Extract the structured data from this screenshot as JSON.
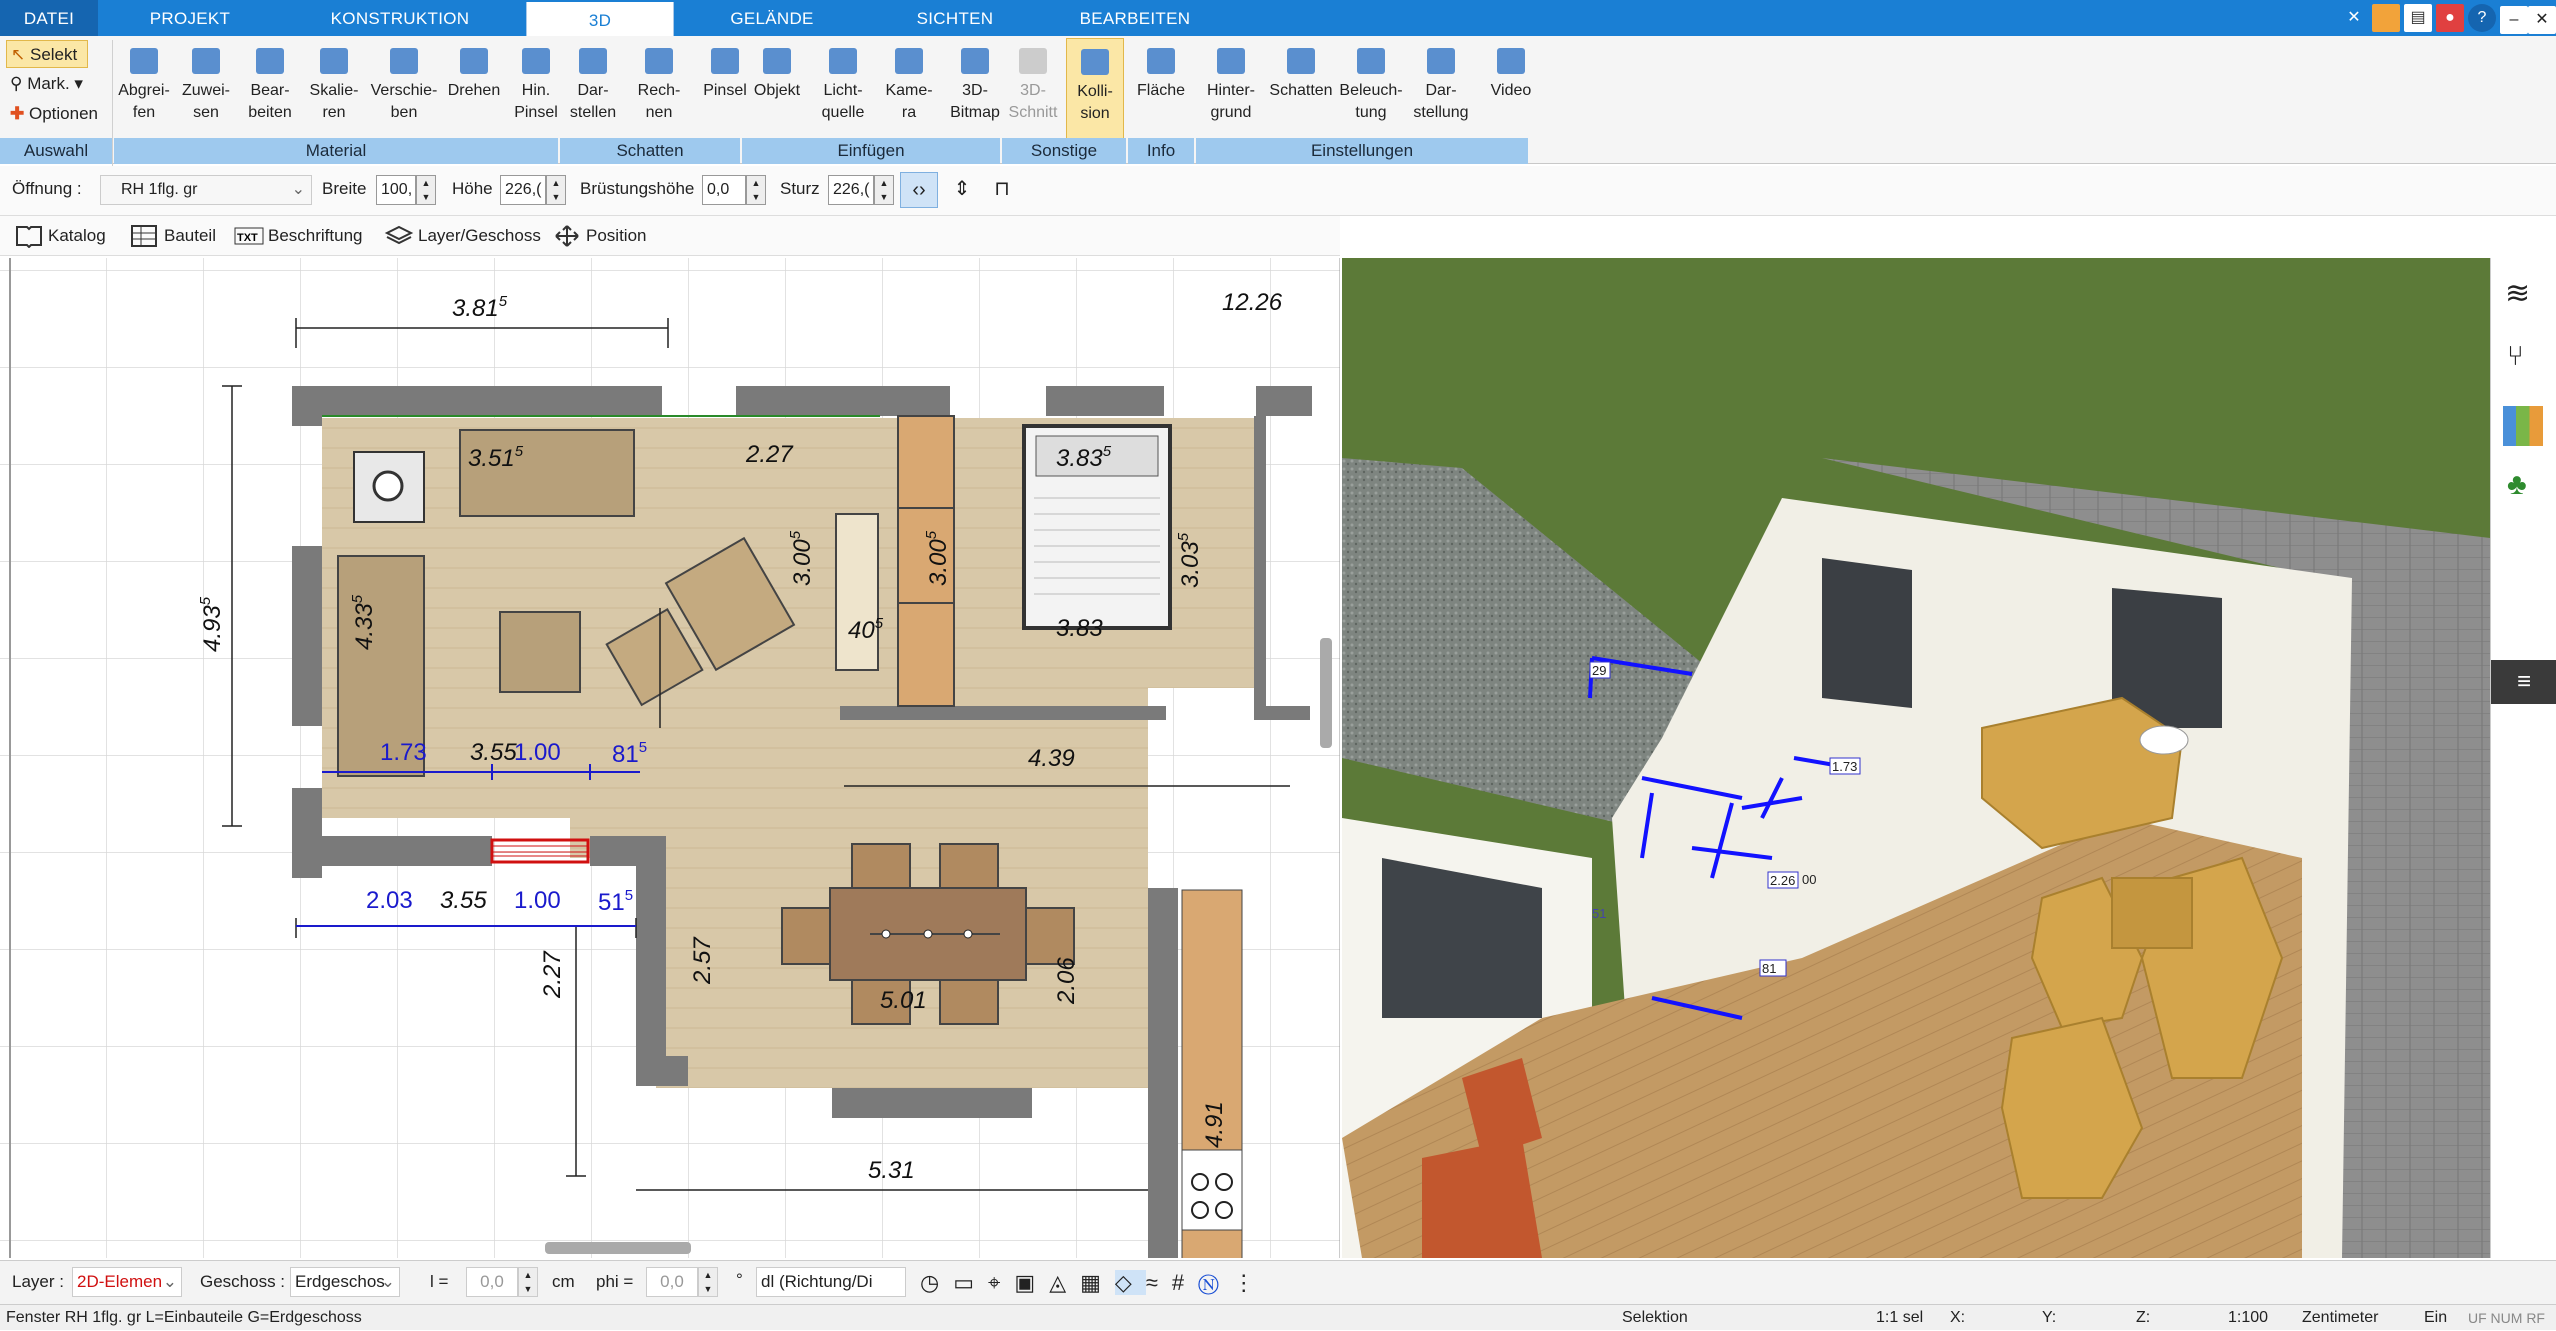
{
  "tabs": [
    "DATEI",
    "PROJEKT",
    "KONSTRUKTION",
    "3D",
    "GELÄNDE",
    "SICHTEN",
    "BEARBEITEN"
  ],
  "ribbon": {
    "auswahl": {
      "select": "Selekt",
      "mark": "Mark.",
      "options": "Optionen",
      "group": "Auswahl"
    },
    "material": {
      "group": "Material",
      "buttons": [
        "Abgrei-\nfen",
        "Zuwei-\nsen",
        "Bear-\nbeiten",
        "Skalie-\nren",
        "Verschie-\nben",
        "Drehen",
        "Hin.\nPinsel"
      ]
    },
    "schatten": {
      "group": "Schatten",
      "buttons": [
        "Dar-\nstellen",
        "Rech-\nnen",
        "Pinsel"
      ]
    },
    "einfuegen": {
      "group": "Einfügen",
      "buttons": [
        "Objekt",
        "Licht-\nquelle",
        "Kame-\nra",
        "3D-\nBitmap"
      ]
    },
    "sonstige": {
      "group": "Sonstige",
      "buttons": [
        "3D-\nSchnitt",
        "Kolli-\nsion"
      ]
    },
    "info": {
      "group": "Info",
      "buttons": [
        "Fläche"
      ]
    },
    "einstellungen": {
      "group": "Einstellungen",
      "buttons": [
        "Hinter-\ngrund",
        "Schatten",
        "Beleuch-\ntung",
        "Dar-\nstellung",
        "Video"
      ]
    }
  },
  "props": {
    "opening_label": "Öffnung :",
    "opening_value": "RH 1flg. gr",
    "width_label": "Breite",
    "width_value": "100,",
    "height_label": "Höhe",
    "height_value": "226,(",
    "sill_label": "Brüstungshöhe",
    "sill_value": "0,0",
    "lintel_label": "Sturz",
    "lintel_value": "226,("
  },
  "toolbar2": [
    "Katalog",
    "Bauteil",
    "Beschriftung",
    "Layer/Geschoss",
    "Position"
  ],
  "plan_dims": {
    "d_381": "3.81",
    "d_381s": "5",
    "d_1226": "12.26",
    "d_351": "3.51",
    "d_351s": "5",
    "d_227": "2.27",
    "d_383a": "3.83",
    "d_383s": "5",
    "d_383b": "3.83",
    "d_300a": "3.00",
    "d_300as": "5",
    "d_300b": "3.00",
    "d_300bs": "5",
    "d_303": "3.03",
    "d_303s": "5",
    "d_40": "40",
    "d_40s": "5",
    "d_493": "4.93",
    "d_493s": "5",
    "d_433": "4.33",
    "d_433s": "5",
    "d_173": "1.73",
    "d_355a": "3.55",
    "d_100a": "1.00",
    "d_81": "81",
    "d_81s": "5",
    "d_439": "4.39",
    "d_203": "2.03",
    "d_355b": "3.55",
    "d_100b": "1.00",
    "d_51": "51",
    "d_51s": "5",
    "d_227b": "2.27",
    "d_257": "2.57",
    "d_501": "5.01",
    "d_206": "2.06",
    "d_531": "5.31",
    "d_491": "4.91"
  },
  "view3d_labels": {
    "l29": "29",
    "l173": "1.73",
    "l226": "2.26",
    "l00": "00",
    "l81": "81",
    "l51": "51"
  },
  "bottom": {
    "layer_label": "Layer :",
    "layer_value": "2D-Elemen",
    "floor_label": "Geschoss :",
    "floor_value": "Erdgeschos",
    "l_label": "l =",
    "l_value": "0,0",
    "l_unit": "cm",
    "phi_label": "phi =",
    "phi_value": "0,0",
    "phi_unit": "°",
    "dl_value": "dl (Richtung/Di"
  },
  "status": {
    "left": "Fenster RH 1flg. gr L=Einbauteile G=Erdgeschoss",
    "mode": "Selektion",
    "sel": "1:1 sel",
    "x": "X:",
    "y": "Y:",
    "z": "Z:",
    "scale": "1:100",
    "unit": "Zentimeter",
    "ein": "Ein",
    "flags": "UF NUM RF"
  },
  "colors": {
    "tabbar": "#1a7fd4",
    "group": "#9ec9ee",
    "floor": "#d5c6a8",
    "grass": "#5c7a38"
  }
}
